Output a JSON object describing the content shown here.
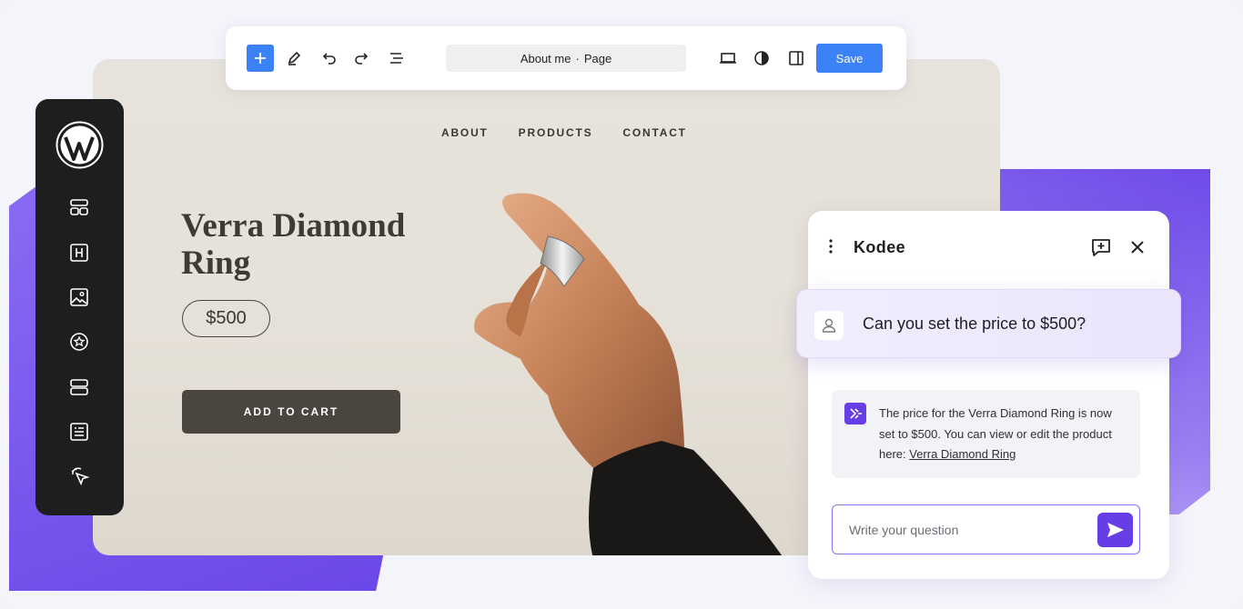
{
  "toolbar": {
    "doc_title": "About me",
    "doc_type": "Page",
    "save_label": "Save",
    "icons": [
      "add-block-icon",
      "pen-icon",
      "undo-icon",
      "redo-icon",
      "list-view-icon",
      "laptop-icon",
      "contrast-icon",
      "sidebar-toggle-icon"
    ]
  },
  "sidebar": {
    "logo": "wordpress-logo",
    "items": [
      "layout-grid-icon",
      "heading-icon",
      "image-icon",
      "star-badge-icon",
      "stack-icon",
      "form-icon",
      "cursor-click-icon"
    ]
  },
  "site": {
    "nav": [
      "ABOUT",
      "PRODUCTS",
      "CONTACT"
    ],
    "product_title": "Verra Diamond Ring",
    "price": "$500",
    "add_to_cart": "ADD TO CART"
  },
  "kodee": {
    "title": "Kodee",
    "user_message": "Can you set the price to $500?",
    "ai_message_prefix": "The price for the Verra Diamond Ring is now set to $500. You can view or edit the product here: ",
    "ai_message_link": "Verra Diamond Ring",
    "input_placeholder": "Write your question"
  },
  "colors": {
    "accent_blue": "#3b82f6",
    "kodee_purple": "#673de6",
    "sidebar_dark": "#1e1e1e",
    "button_dark": "#4a453e"
  }
}
